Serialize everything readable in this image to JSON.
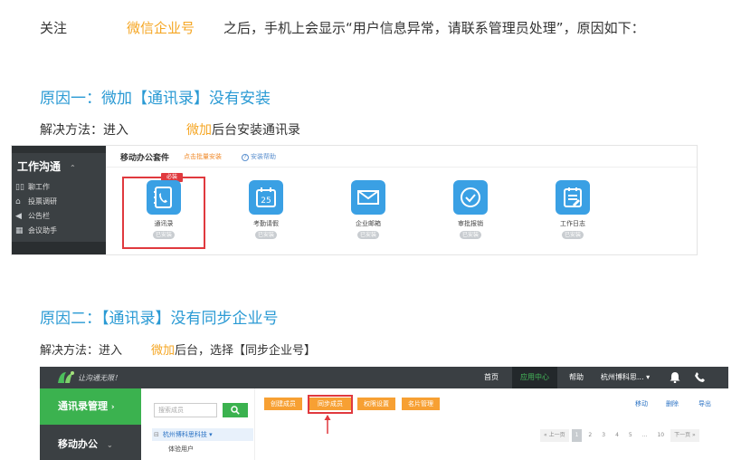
{
  "intro": {
    "prefix": "关注",
    "product": "微信企业号",
    "suffix": "之后，手机上会显示“用户信息异常，请联系管理员处理”，原因如下："
  },
  "reason1": {
    "title": "原因一：微加【通讯录】没有安装",
    "solve_prefix": "解决方法：进入",
    "solve_brand": "微加",
    "solve_suffix": "后台安装通讯录"
  },
  "reason2": {
    "title": "原因二：【通讯录】没有同步企业号",
    "solve_prefix": "解决方法：进入",
    "solve_brand": "微加",
    "solve_suffix": "后台，选择【同步企业号】"
  },
  "screenshot1": {
    "sidebar_group": "工作沟通",
    "sidebar_items": [
      {
        "icon": "grid-icon",
        "label": "聊工作"
      },
      {
        "icon": "home-icon",
        "label": "投票调研"
      },
      {
        "icon": "megaphone-icon",
        "label": "公告栏"
      },
      {
        "icon": "calendar-icon",
        "label": "会议助手"
      }
    ],
    "header_title": "移动办公套件",
    "header_link": "点击批量安装",
    "header_help": "安装帮助",
    "required_badge": "必装",
    "apps": [
      {
        "icon": "contacts-icon",
        "label": "通讯录",
        "status": "已安装"
      },
      {
        "icon": "attendance-icon",
        "label": "考勤请假",
        "status": "已安装"
      },
      {
        "icon": "mail-icon",
        "label": "企业邮箱",
        "status": "已安装"
      },
      {
        "icon": "approval-icon",
        "label": "审批报销",
        "status": "已安装"
      },
      {
        "icon": "journal-icon",
        "label": "工作日志",
        "status": "已安装"
      }
    ]
  },
  "screenshot2": {
    "slogan": "让沟通无限！",
    "nav": [
      "首页",
      "应用中心",
      "帮助",
      "杭州博科思..."
    ],
    "side_current": "通讯录管理",
    "side_next": "移动办公",
    "search_placeholder": "搜索成员",
    "org_name": "杭州博科思科技",
    "user": "体验用户",
    "buttons": [
      "创建成员",
      "同步成员",
      "权限设置",
      "名片管理"
    ],
    "actions": [
      "移动",
      "删除",
      "导出"
    ],
    "pager": [
      "« 上一页",
      "1",
      "2",
      "3",
      "4",
      "5",
      "...",
      "10",
      "下一页 »"
    ],
    "colors": {
      "green": "#3bb24f",
      "orange": "#f7a033",
      "highlight": "#e0393e"
    }
  }
}
